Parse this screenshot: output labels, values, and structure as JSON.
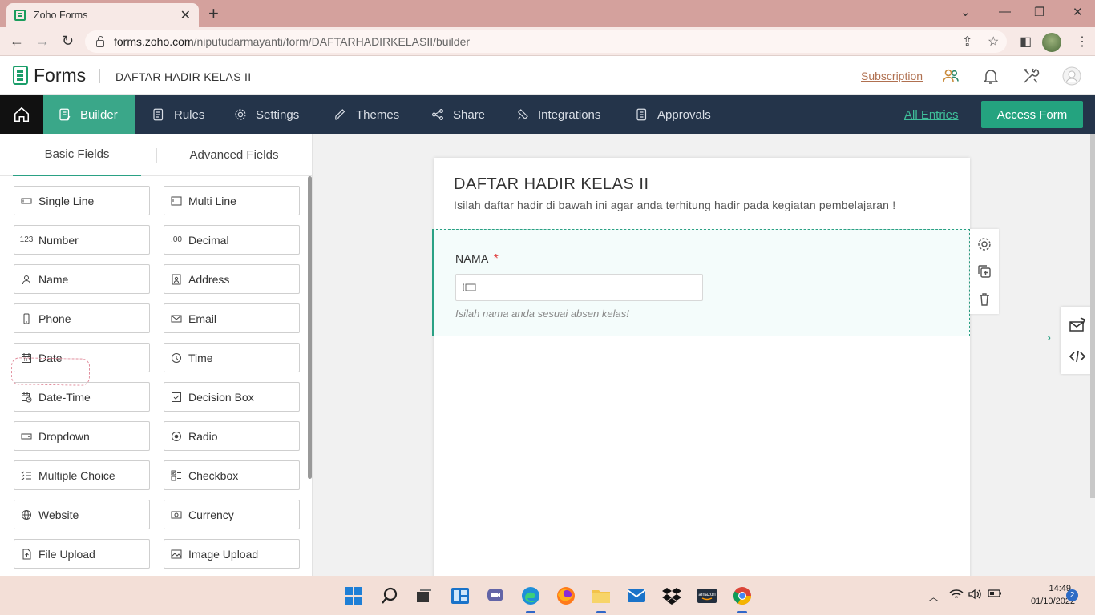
{
  "browser": {
    "tab_title": "Zoho Forms",
    "url_host": "forms.zoho.com",
    "url_path": "/niputudarmayanti/form/DAFTARHADIRKELASII/builder"
  },
  "header": {
    "app_name": "Forms",
    "form_name": "DAFTAR HADIR KELAS II",
    "subscription": "Subscription"
  },
  "nav": {
    "items": [
      {
        "label": "Builder"
      },
      {
        "label": "Rules"
      },
      {
        "label": "Settings"
      },
      {
        "label": "Themes"
      },
      {
        "label": "Share"
      },
      {
        "label": "Integrations"
      },
      {
        "label": "Approvals"
      }
    ],
    "all_entries": "All Entries",
    "access_form": "Access Form"
  },
  "left_panel": {
    "tabs": [
      "Basic Fields",
      "Advanced Fields"
    ],
    "fields": [
      {
        "label": "Single Line",
        "icon": "single-line-icon"
      },
      {
        "label": "Multi Line",
        "icon": "multi-line-icon"
      },
      {
        "label": "Number",
        "icon": "number-icon"
      },
      {
        "label": "Decimal",
        "icon": "decimal-icon"
      },
      {
        "label": "Name",
        "icon": "person-icon"
      },
      {
        "label": "Address",
        "icon": "address-icon"
      },
      {
        "label": "Phone",
        "icon": "phone-icon"
      },
      {
        "label": "Email",
        "icon": "mail-icon"
      },
      {
        "label": "Date",
        "icon": "calendar-icon"
      },
      {
        "label": "Time",
        "icon": "clock-icon"
      },
      {
        "label": "Date-Time",
        "icon": "date-time-icon"
      },
      {
        "label": "Decision Box",
        "icon": "checkbox-icon"
      },
      {
        "label": "Dropdown",
        "icon": "dropdown-icon"
      },
      {
        "label": "Radio",
        "icon": "radio-icon"
      },
      {
        "label": "Multiple Choice",
        "icon": "multiple-choice-icon"
      },
      {
        "label": "Checkbox",
        "icon": "checklist-icon"
      },
      {
        "label": "Website",
        "icon": "globe-icon"
      },
      {
        "label": "Currency",
        "icon": "currency-icon"
      },
      {
        "label": "File Upload",
        "icon": "file-upload-icon"
      },
      {
        "label": "Image Upload",
        "icon": "image-upload-icon"
      }
    ],
    "number_glyph": "123",
    "decimal_glyph": ".00"
  },
  "form": {
    "title": "DAFTAR HADIR KELAS II",
    "description": "Isilah daftar hadir di bawah ini agar anda terhitung hadir pada kegiatan pembelajaran !",
    "field": {
      "label": "NAMA",
      "required_mark": "*",
      "hint": "Isilah nama anda sesuai absen kelas!"
    }
  },
  "taskbar": {
    "time": "14:49",
    "date": "01/10/2022",
    "notifications": "2",
    "amazon_label": "amazon"
  },
  "colors": {
    "accent": "#24a37f",
    "nav_bg": "#24344a",
    "tabbar": "#d4a19d"
  }
}
